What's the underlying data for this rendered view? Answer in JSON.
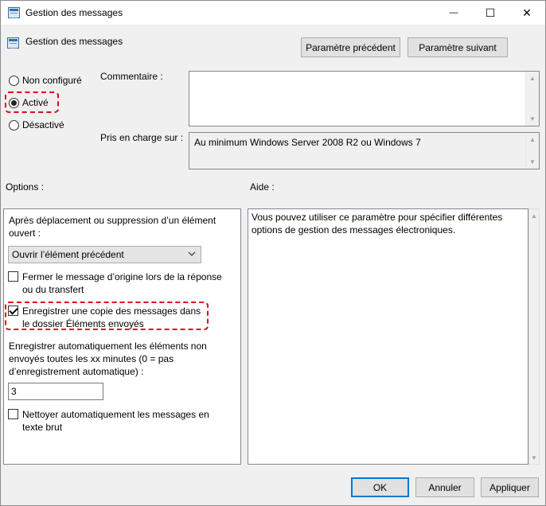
{
  "window": {
    "title": "Gestion des messages",
    "minimize_glyph": "—",
    "maximize_glyph": "☐",
    "close_glyph": "✕"
  },
  "header": {
    "setting_name": "Gestion des messages",
    "prev_button": "Paramètre précédent",
    "next_button": "Paramètre suivant"
  },
  "state": {
    "options": [
      {
        "label": "Non configuré",
        "checked": false
      },
      {
        "label": "Activé",
        "checked": true
      },
      {
        "label": "Désactivé",
        "checked": false
      }
    ]
  },
  "comment": {
    "label": "Commentaire :",
    "value": ""
  },
  "supported": {
    "label": "Pris en charge sur :",
    "value": "Au minimum Windows Server 2008 R2 ou Windows 7"
  },
  "options_panel": {
    "label": "Options :",
    "after_move_label": "Après déplacement ou suppression d’un élément ouvert :",
    "after_move_select": "Ouvrir l’élément précédent",
    "close_original": "Fermer le message d’origine lors de la réponse ou du transfert",
    "save_copy": "Enregistrer une copie des messages dans le dossier Éléments envoyés",
    "autosave_label": "Enregistrer automatiquement les éléments non envoyés toutes les xx minutes (0 = pas d’enregistrement  automatique) :",
    "autosave_value": "3",
    "plain_text": "Nettoyer automatiquement les messages en texte brut"
  },
  "help_panel": {
    "label": "Aide :",
    "text": "Vous pouvez utiliser ce paramètre pour spécifier différentes options de gestion des messages électroniques."
  },
  "footer": {
    "ok": "OK",
    "cancel": "Annuler",
    "apply": "Appliquer"
  },
  "colors": {
    "highlight": "#e0001b",
    "default_button_border": "#0078d7"
  },
  "icons": {
    "up_arrow": "▲",
    "down_arrow": "▼",
    "chevron": "⌄"
  }
}
